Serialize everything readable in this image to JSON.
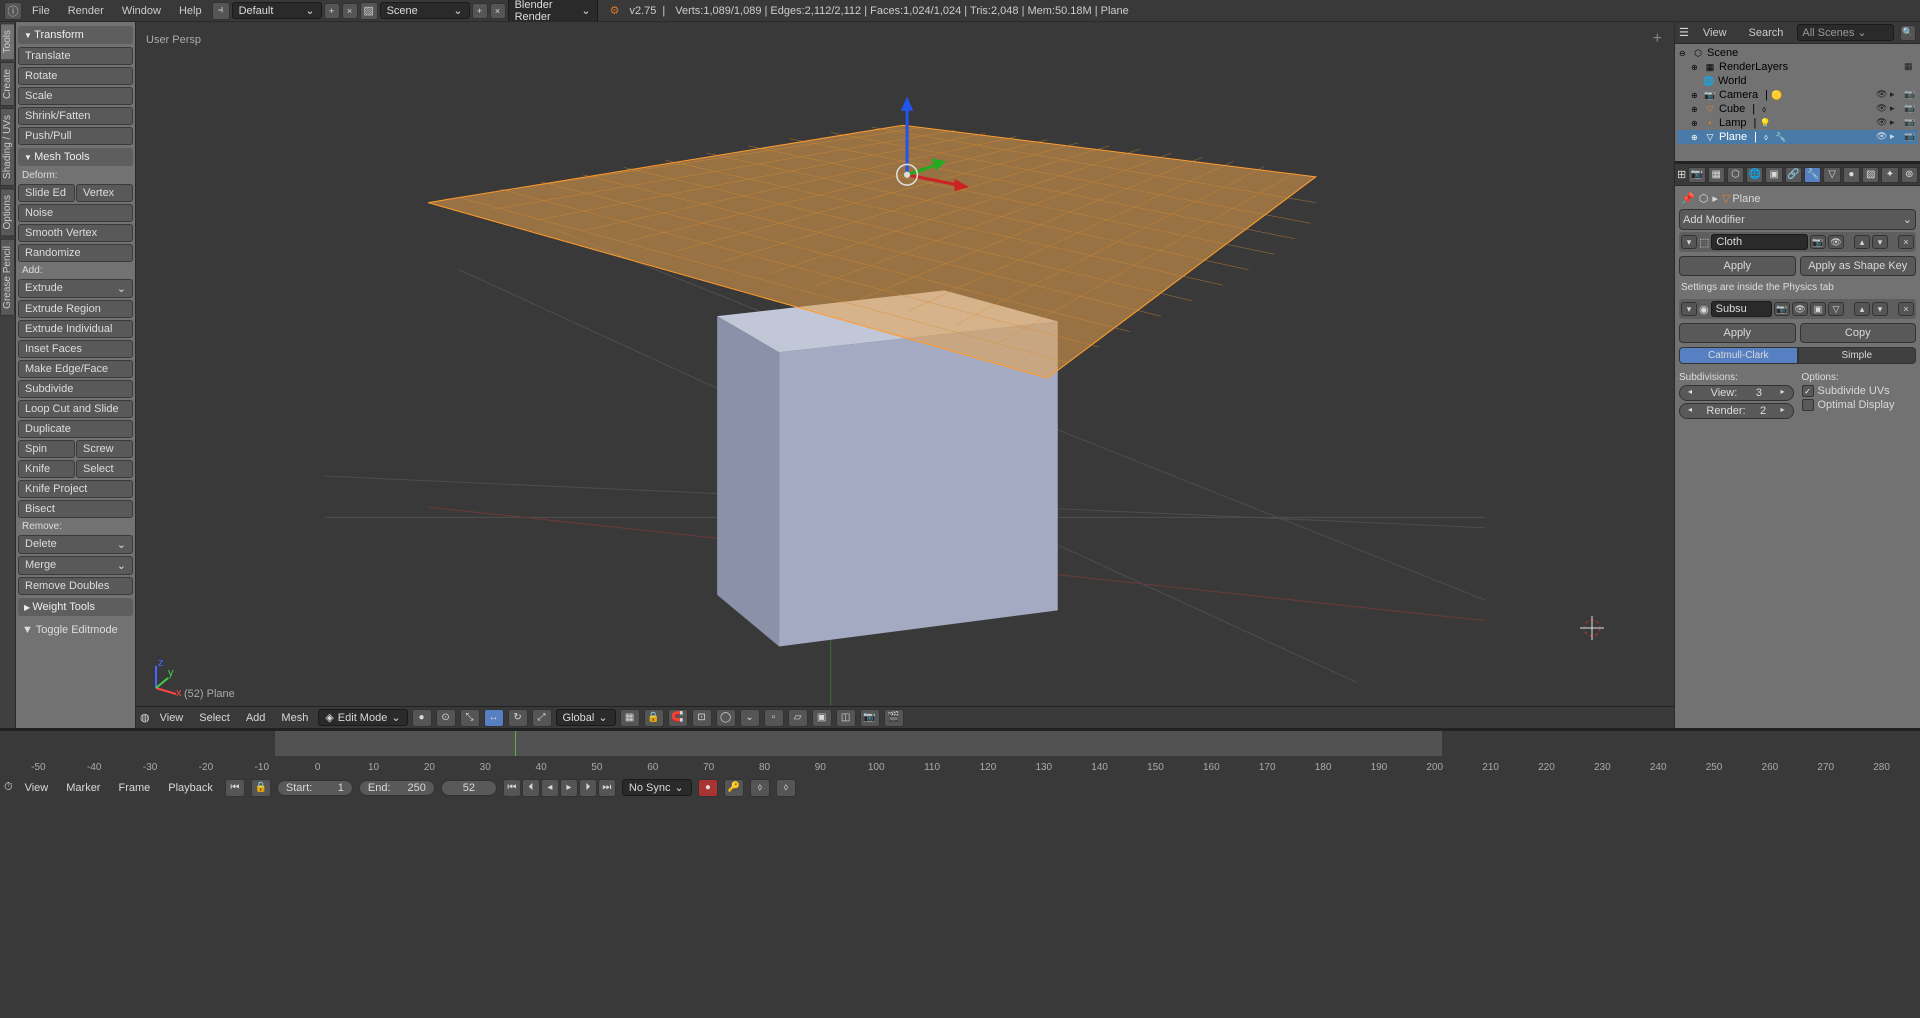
{
  "topbar": {
    "menus": [
      "File",
      "Render",
      "Window",
      "Help"
    ],
    "layout": "Default",
    "scene": "Scene",
    "engine": "Blender Render",
    "version": "v2.75",
    "stats": "Verts:1,089/1,089 | Edges:2,112/2,112 | Faces:1,024/1,024 | Tris:2,048 | Mem:50.18M | Plane"
  },
  "left_tabs": [
    "Tools",
    "Create",
    "Shading / UVs",
    "Options",
    "Grease Pencil"
  ],
  "tool_panel": {
    "transform_header": "Transform",
    "transform": [
      "Translate",
      "Rotate",
      "Scale",
      "Shrink/Fatten",
      "Push/Pull"
    ],
    "mesh_header": "Mesh Tools",
    "deform_label": "Deform:",
    "deform_row": [
      "Slide Ed",
      "Vertex"
    ],
    "deform": [
      "Noise",
      "Smooth Vertex",
      "Randomize"
    ],
    "add_label": "Add:",
    "add_primary": "Extrude",
    "add_tools": [
      "Extrude Region",
      "Extrude Individual",
      "Inset Faces",
      "Make Edge/Face",
      "Subdivide",
      "Loop Cut and Slide",
      "Duplicate"
    ],
    "spin_row": [
      "Spin",
      "Screw"
    ],
    "knife_row": [
      "Knife",
      "Select"
    ],
    "knife_extra": [
      "Knife Project",
      "Bisect"
    ],
    "remove_label": "Remove:",
    "remove": [
      "Delete",
      "Merge",
      "Remove Doubles"
    ],
    "weight_header": "Weight Tools",
    "history_header": "Toggle Editmode"
  },
  "viewport": {
    "label": "User Persp",
    "info": "(52) Plane",
    "menus": [
      "View",
      "Select",
      "Add",
      "Mesh"
    ],
    "mode": "Edit Mode",
    "orientation": "Global"
  },
  "outliner": {
    "menus": [
      "View",
      "Search"
    ],
    "filter": "All Scenes",
    "root": "Scene",
    "renderlayers": "RenderLayers",
    "world": "World",
    "objects": [
      {
        "name": "Camera",
        "icon": "📷"
      },
      {
        "name": "Cube",
        "icon": "▽"
      },
      {
        "name": "Lamp",
        "icon": "•"
      },
      {
        "name": "Plane",
        "icon": "▽",
        "active": true
      }
    ]
  },
  "properties": {
    "breadcrumb": "Plane",
    "add_modifier": "Add Modifier",
    "cloth": {
      "name": "Cloth",
      "apply": "Apply",
      "apply_shape": "Apply as Shape Key",
      "note": "Settings are inside the Physics tab"
    },
    "subsurf": {
      "name": "Subsu",
      "apply": "Apply",
      "copy": "Copy",
      "catmull": "Catmull-Clark",
      "simple": "Simple",
      "subdivisions_label": "Subdivisions:",
      "view_label": "View:",
      "view_val": "3",
      "render_label": "Render:",
      "render_val": "2",
      "options_label": "Options:",
      "subdivide_uvs": "Subdivide UVs",
      "optimal_display": "Optimal Display"
    }
  },
  "timeline": {
    "menus": [
      "View",
      "Marker",
      "Frame",
      "Playback"
    ],
    "start_label": "Start:",
    "start_val": "1",
    "end_label": "End:",
    "end_val": "250",
    "current": "52",
    "sync": "No Sync",
    "ticks": [
      "-50",
      "-40",
      "-30",
      "-20",
      "-10",
      "0",
      "10",
      "20",
      "30",
      "40",
      "50",
      "60",
      "70",
      "80",
      "90",
      "100",
      "110",
      "120",
      "130",
      "140",
      "150",
      "160",
      "170",
      "180",
      "190",
      "200",
      "210",
      "220",
      "230",
      "240",
      "250",
      "260",
      "270",
      "280"
    ]
  }
}
